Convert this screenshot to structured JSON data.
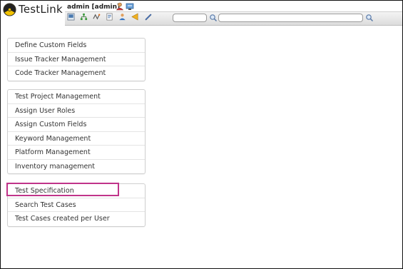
{
  "app": {
    "name": "TestLink"
  },
  "header": {
    "user_label": "admin [admin]",
    "search_input_1": {
      "value": "",
      "placeholder": ""
    },
    "search_input_2": {
      "value": "",
      "placeholder": ""
    }
  },
  "menus": {
    "group1": [
      {
        "label": "Define Custom Fields"
      },
      {
        "label": "Issue Tracker Management"
      },
      {
        "label": "Code Tracker Management"
      }
    ],
    "group2": [
      {
        "label": "Test Project Management"
      },
      {
        "label": "Assign User Roles"
      },
      {
        "label": "Assign Custom Fields"
      },
      {
        "label": "Keyword Management"
      },
      {
        "label": "Platform Management"
      },
      {
        "label": "Inventory management"
      }
    ],
    "group3": [
      {
        "label": "Test Specification"
      },
      {
        "label": "Search Test Cases"
      },
      {
        "label": "Test Cases created per User"
      }
    ]
  },
  "highlight": {
    "target": "Test Specification",
    "color": "#c0348a"
  },
  "colors": {
    "highlight": "#c0348a",
    "text": "#333333",
    "border": "#cfcfcf"
  }
}
